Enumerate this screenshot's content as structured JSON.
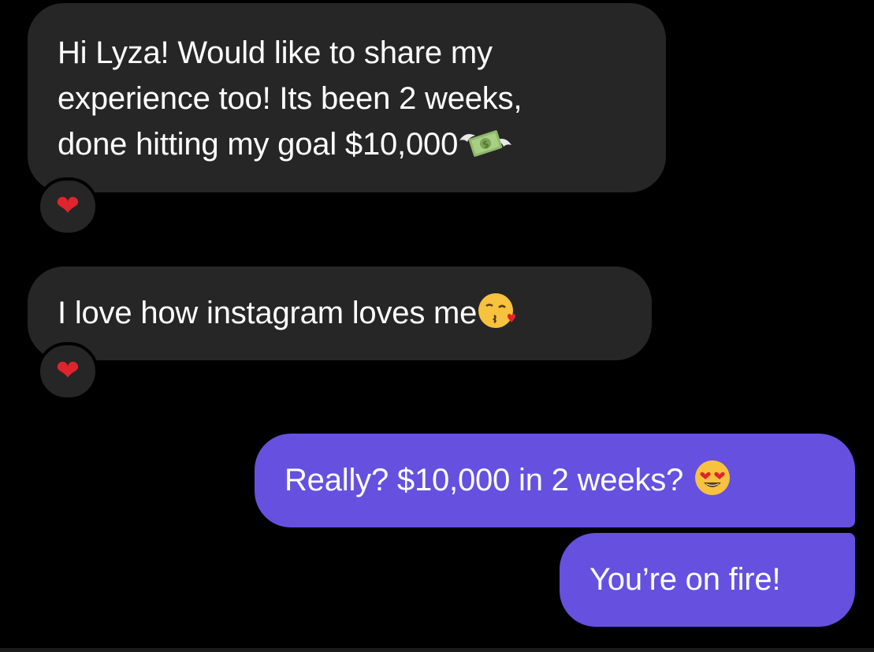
{
  "messages": [
    {
      "direction": "incoming",
      "lines": [
        "Hi Lyza! Would like to share my",
        "experience too! Its been 2 weeks,",
        "done hitting my goal $10,000"
      ],
      "emoji": "money-with-wings",
      "reaction": "❤"
    },
    {
      "direction": "incoming",
      "lines": [
        "I love how instagram loves me"
      ],
      "emoji": "face-blowing-a-kiss",
      "reaction": "❤"
    },
    {
      "direction": "outgoing",
      "lines": [
        "Really? $10,000 in 2 weeks?"
      ],
      "emoji": "smiling-face-with-heart-eyes"
    },
    {
      "direction": "outgoing",
      "lines": [
        "You’re on fire!"
      ]
    }
  ],
  "colors": {
    "background": "#000000",
    "incoming_bubble": "#262626",
    "outgoing_bubble": "#6650e0",
    "text": "#ffffff",
    "reaction_heart": "#e0242e"
  }
}
